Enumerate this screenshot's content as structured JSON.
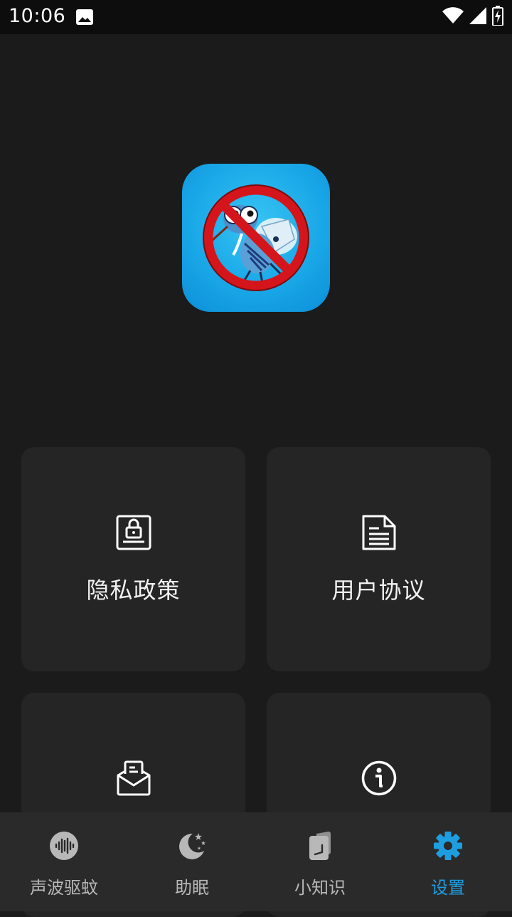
{
  "status_bar": {
    "time": "10:06",
    "icons": [
      "image-icon",
      "wifi-icon",
      "signal-icon",
      "battery-charging-icon"
    ]
  },
  "app_icon": {
    "icon": "no-mosquito-logo"
  },
  "cards": [
    {
      "label": "隐私政策",
      "icon": "privacy-lock-document-icon"
    },
    {
      "label": "用户协议",
      "icon": "document-icon"
    },
    {
      "label": "",
      "icon": "mail-open-icon"
    },
    {
      "label": "",
      "icon": "info-icon"
    }
  ],
  "bottom_nav": {
    "items": [
      {
        "label": "声波驱蚊",
        "icon": "sound-wave-icon",
        "active": false
      },
      {
        "label": "助眠",
        "icon": "moon-stars-icon",
        "active": false
      },
      {
        "label": "小知识",
        "icon": "knowledge-card-icon",
        "active": false
      },
      {
        "label": "设置",
        "icon": "gear-icon",
        "active": true
      }
    ],
    "active_color": "#1e9de0",
    "inactive_color": "#b8b8b8"
  }
}
